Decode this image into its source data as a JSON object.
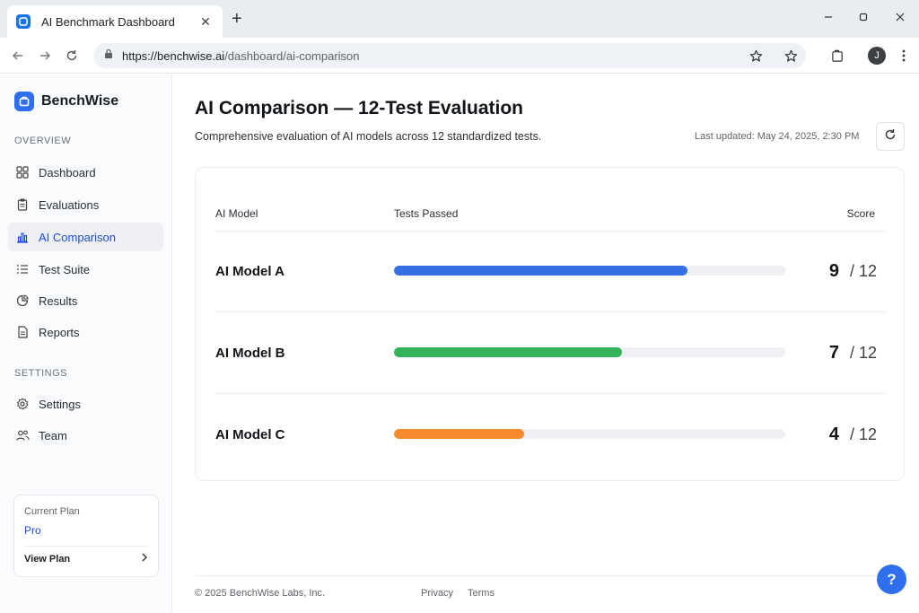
{
  "browser": {
    "tab_title": "AI Benchmark Dashboard",
    "url_host": "https://benchwise.ai",
    "url_path": "/dashboard/ai-comparison",
    "profile_initial": "J"
  },
  "sidebar": {
    "brand": "BenchWise",
    "overview_label": "OVERVIEW",
    "settings_label": "SETTINGS",
    "overview_items": [
      {
        "label": "Dashboard",
        "icon": "grid-icon"
      },
      {
        "label": "Evaluations",
        "icon": "clipboard-icon"
      },
      {
        "label": "AI Comparison",
        "icon": "bar-chart-icon",
        "active": true
      },
      {
        "label": "Test Suite",
        "icon": "list-icon"
      },
      {
        "label": "Results",
        "icon": "pie-chart-icon"
      },
      {
        "label": "Reports",
        "icon": "document-icon"
      }
    ],
    "settings_items": [
      {
        "label": "Settings",
        "icon": "gear-icon"
      },
      {
        "label": "Team",
        "icon": "users-icon"
      }
    ],
    "plan": {
      "label": "Current Plan",
      "value": "Pro",
      "link": "View Plan"
    }
  },
  "main": {
    "title": "AI Comparison — 12-Test Evaluation",
    "subtitle": "Comprehensive evaluation of AI models across 12 standardized tests.",
    "last_updated": "Last updated: May 24, 2025, 2:30 PM",
    "table": {
      "headers": [
        "AI Model",
        "Tests Passed",
        "Score"
      ],
      "rows": [
        {
          "model": "AI Model A",
          "passed": 9,
          "total": "/ 12",
          "color": "#3470e4"
        },
        {
          "model": "AI Model B",
          "passed": 7,
          "total": "/ 12",
          "color": "#34b35a"
        },
        {
          "model": "AI Model C",
          "passed": 4,
          "total": "/ 12",
          "color": "#f58a2e"
        }
      ],
      "max": 12
    }
  },
  "footer": {
    "copyright": "© 2025 BenchWise Labs, Inc.",
    "privacy": "Privacy",
    "terms": "Terms"
  },
  "help_label": "?",
  "colors": {
    "accent": "#2f6fed"
  }
}
